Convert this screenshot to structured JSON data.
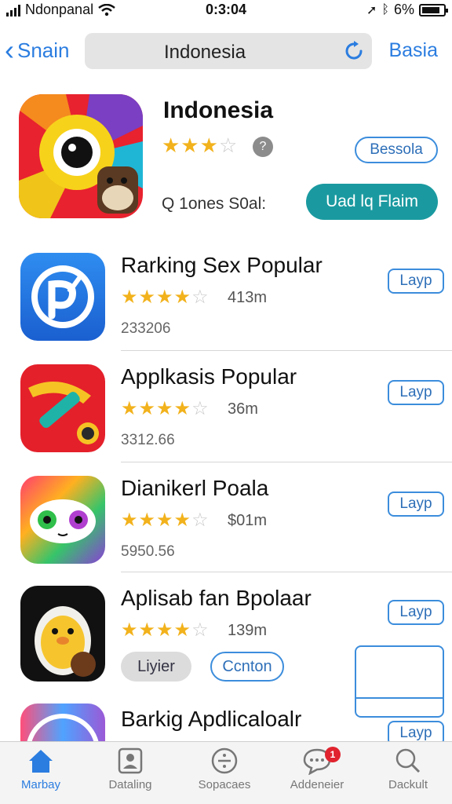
{
  "status_bar": {
    "carrier": "Ndonpanal",
    "time": "0:3:04",
    "battery": "6%"
  },
  "nav": {
    "back_label": "Snain",
    "search_text": "Indonesia",
    "right_label": "Basia"
  },
  "featured": {
    "title": "Indonesia",
    "rating": 3,
    "info_icon": "?",
    "outline_button": "Bessola",
    "subtitle": "Q 1ones S0al:",
    "main_button": "Uad lq Flaim"
  },
  "apps": [
    {
      "name": "Rarking Sex Popular",
      "rating": 4.5,
      "size": "413m",
      "number": "233206",
      "button": "Layp"
    },
    {
      "name": "Applkasis Popular",
      "rating": 4.5,
      "size": "36m",
      "number": "3312.66",
      "button": "Layp"
    },
    {
      "name": "Dianikerl Poala",
      "rating": 4.5,
      "size": "$01m",
      "number": "5950.56",
      "button": "Layp"
    },
    {
      "name": "Aplisab fan Bpolaar",
      "rating": 4.5,
      "size": "139m",
      "button": "Layp",
      "pill_gray": "Liyier",
      "pill_blue": "Ccnton"
    },
    {
      "name": "Barkig Apdlicaloalr",
      "button": "Layp"
    }
  ],
  "tabs": [
    {
      "label": "Marbay",
      "icon": "home-icon",
      "active": true
    },
    {
      "label": "Dataling",
      "icon": "profile-icon"
    },
    {
      "label": "Sopacaes",
      "icon": "divide-icon"
    },
    {
      "label": "Addeneier",
      "icon": "chat-icon",
      "badge": "1"
    },
    {
      "label": "Dackult",
      "icon": "search-icon"
    }
  ],
  "colors": {
    "accent": "#2b7de0",
    "teal_button": "#1a9aa0",
    "star": "#f2b21c",
    "badge": "#e0232e"
  }
}
